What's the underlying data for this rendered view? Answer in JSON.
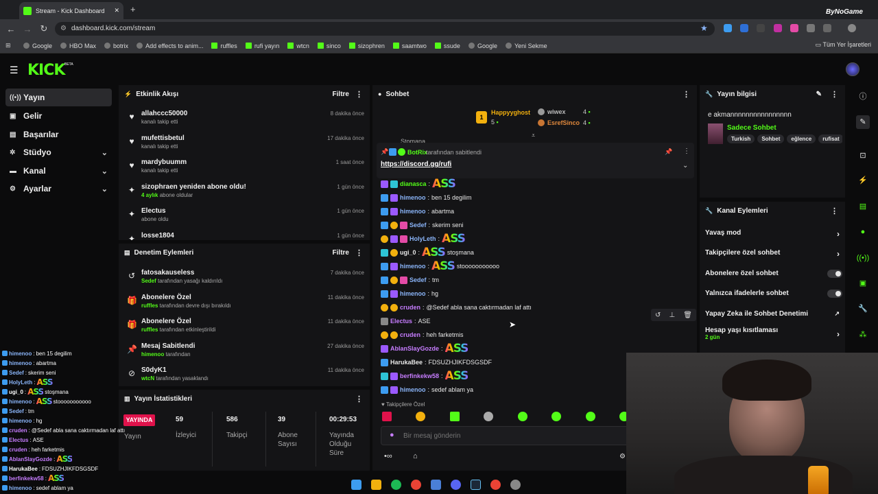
{
  "browser": {
    "tab_title": "Stream - Kick Dashboard",
    "url": "dashboard.kick.com/stream",
    "bookmarks": [
      "Google",
      "HBO Max",
      "botrix",
      "Add effects to anim...",
      "ruffles",
      "rufi yayın",
      "wtcn",
      "sinco",
      "sizophren",
      "saamtwo",
      "ssude",
      "Google",
      "Yeni Sekme"
    ],
    "all_bookmarks": "Tüm Yer İşaretleri",
    "overlay_brand": "ByNoGame"
  },
  "app": {
    "logo": "KICK",
    "beta": "BETA"
  },
  "nav": [
    {
      "label": "Yayın",
      "icon": "stream-icon",
      "active": true
    },
    {
      "label": "Gelir",
      "icon": "revenue-icon"
    },
    {
      "label": "Başarılar",
      "icon": "achievements-icon"
    },
    {
      "label": "Stüdyo",
      "icon": "studio-icon",
      "chevron": true
    },
    {
      "label": "Kanal",
      "icon": "channel-icon",
      "chevron": true
    },
    {
      "label": "Ayarlar",
      "icon": "settings-icon",
      "chevron": true
    }
  ],
  "activity": {
    "title": "Etkinlik Akışı",
    "filter": "Filtre",
    "events": [
      {
        "name": "allahccc50000",
        "sub": "kanalı takip etti",
        "time": "8 dakika önce",
        "icon": "heart-icon"
      },
      {
        "name": "mufettisbetul",
        "sub": "kanalı takip etti",
        "time": "17 dakika önce",
        "icon": "heart-icon"
      },
      {
        "name": "mardybuumm",
        "sub": "kanalı takip etti",
        "time": "1 saat önce",
        "icon": "heart-icon"
      },
      {
        "name": "sizophraen yeniden abone oldu!",
        "sub_hl": "4 aylık",
        "sub": " abone oldular",
        "time": "1 gün önce",
        "icon": "star-icon"
      },
      {
        "name": "Electus",
        "sub": "abone oldu",
        "time": "1 gün önce",
        "icon": "star-icon"
      },
      {
        "name": "losse1804",
        "sub": "",
        "time": "1 gün önce",
        "icon": "star-icon"
      }
    ]
  },
  "moderation": {
    "title": "Denetim Eylemleri",
    "filter": "Filtre",
    "events": [
      {
        "name": "fatosakauseless",
        "sub_hl": "Sedef",
        "sub": " tarafından yasağı kaldırıldı",
        "time": "7 dakika önce",
        "icon": "undo-icon"
      },
      {
        "name": "Abonelere Özel",
        "sub_hl": "ruffles",
        "sub": " tarafından devre dışı bırakıldı",
        "time": "11 dakika önce",
        "icon": "gift-icon"
      },
      {
        "name": "Abonelere Özel",
        "sub_hl": "ruffles",
        "sub": " tarafından etkinleştirildi",
        "time": "11 dakika önce",
        "icon": "gift-icon"
      },
      {
        "name": "Mesaj Sabitlendi",
        "sub_hl": "himenoo",
        "sub": " tarafından",
        "time": "27 dakika önce",
        "icon": "pin-icon"
      },
      {
        "name": "S0dyK1",
        "sub_hl": "wtcN",
        "sub": " tarafından yasaklandı",
        "time": "11 dakika önce",
        "icon": "ban-icon"
      }
    ]
  },
  "stats": {
    "title": "Yayın İstatistikleri",
    "live_badge": "YAYINDA",
    "live_label": "Yayın",
    "items": [
      {
        "value": "59",
        "label": "İzleyici"
      },
      {
        "value": "586",
        "label": "Takipçi"
      },
      {
        "value": "39",
        "label": "Abone Sayısı"
      },
      {
        "value": "00:29:53",
        "label": "Yayında Olduğu Süre"
      }
    ]
  },
  "chat": {
    "title": "Sohbet",
    "leaderboard": [
      {
        "name": "Happyyghost",
        "count": "5"
      },
      {
        "name": "wiwex",
        "count": "4"
      },
      {
        "name": "EsrefSinco",
        "count": "4"
      }
    ],
    "pinned_by": "BotRix",
    "pinned_suffix": "tarafından sabitlendi",
    "pinned_link": "https://discord.gg/rufi",
    "peek_name": "Stomana",
    "messages": [
      {
        "user": "dianasca",
        "color": "#53fc18",
        "text": "",
        "emote": "ASS",
        "badges": [
          "purple",
          "cyan"
        ]
      },
      {
        "user": "himenoo",
        "color": "#8ab4f8",
        "text": "ben 15 degilim",
        "badges": [
          "blue",
          "purple"
        ]
      },
      {
        "user": "himenoo",
        "color": "#8ab4f8",
        "text": "abartma",
        "badges": [
          "blue",
          "purple"
        ]
      },
      {
        "user": "Sedef",
        "color": "#8ab4f8",
        "text": "skerim seni",
        "badges": [
          "blue",
          "gold",
          "pink"
        ]
      },
      {
        "user": "HolyLeth",
        "color": "#8ab4f8",
        "text": "",
        "emote": "ASS",
        "badges": [
          "gold",
          "purple",
          "pink"
        ]
      },
      {
        "user": "ugi_0",
        "color": "#e8e8e8",
        "text": "stoşmana",
        "emote": "ASS",
        "badges": [
          "cyan",
          "gold"
        ]
      },
      {
        "user": "himenoo",
        "color": "#8ab4f8",
        "text": "stooooooooooo",
        "emote": "ASS",
        "badges": [
          "blue",
          "purple"
        ]
      },
      {
        "user": "Sedef",
        "color": "#8ab4f8",
        "text": "tm",
        "badges": [
          "blue",
          "gold",
          "pink"
        ]
      },
      {
        "user": "himenoo",
        "color": "#8ab4f8",
        "text": "hg",
        "badges": [
          "blue",
          "purple"
        ]
      },
      {
        "user": "cruden",
        "color": "#c77dff",
        "text": "@Sedef abla sana caktırmadan laf attı",
        "badges": [
          "gold",
          "gold"
        ]
      },
      {
        "user": "Electus",
        "color": "#c77dff",
        "text": "ASE",
        "badges": [
          "gray"
        ]
      },
      {
        "user": "cruden",
        "color": "#c77dff",
        "text": "heh farketmis",
        "badges": [
          "gold",
          "gold"
        ]
      },
      {
        "user": "AblanSlayGozde",
        "color": "#c77dff",
        "text": "",
        "emote": "ASS",
        "badges": [
          "purple"
        ]
      },
      {
        "user": "HarukaBee",
        "color": "#e8e8e8",
        "text": "FDSUZHJIKFDSGSDF",
        "badges": [
          "blue"
        ]
      },
      {
        "user": "berfinkekw58",
        "color": "#c77dff",
        "text": "",
        "emote": "ASS",
        "badges": [
          "cyan",
          "purple"
        ]
      },
      {
        "user": "himenoo",
        "color": "#8ab4f8",
        "text": "sedef ablam ya",
        "badges": [
          "blue",
          "purple"
        ]
      }
    ],
    "followers_only": "Takipçilere Özel",
    "placeholder": "Bir mesaj gönderin"
  },
  "stream_info": {
    "title": "Yayın bilgisi",
    "stream_title": "e akmannnnnnnnnnnnnnnn",
    "category": "Sadece Sohbet",
    "tags": [
      "Turkish",
      "Sohbet",
      "eğlence",
      "rufisat"
    ]
  },
  "channel_actions": {
    "title": "Kanal Eylemleri",
    "items": [
      {
        "label": "Yavaş mod",
        "type": "arrow"
      },
      {
        "label": "Takipçilere özel sohbet",
        "type": "arrow"
      },
      {
        "label": "Abonelere özel sohbet",
        "type": "toggle"
      },
      {
        "label": "Yalnızca ifadelerle sohbet",
        "type": "toggle"
      },
      {
        "label": "Yapay Zeka ile Sohbet Denetimi",
        "type": "external"
      },
      {
        "label": "Hesap yaşı kısıtlaması",
        "sub": "2 gün",
        "type": "arrow"
      }
    ]
  },
  "overlay": [
    {
      "user": "himenoo",
      "text": "ben 15 degilim",
      "color": "#8ab4f8"
    },
    {
      "user": "himenoo",
      "text": "abartma",
      "color": "#8ab4f8"
    },
    {
      "user": "Sedef",
      "text": "skerim seni",
      "color": "#8ab4f8"
    },
    {
      "user": "HolyLeth",
      "text": "",
      "emote": "ASS",
      "color": "#8ab4f8"
    },
    {
      "user": "ugi_0",
      "text": "stoşmana",
      "emote": "ASS",
      "color": "#fff"
    },
    {
      "user": "himenoo",
      "text": "stooooooooooo",
      "emote": "ASS",
      "color": "#8ab4f8"
    },
    {
      "user": "Sedef",
      "text": "tm",
      "color": "#8ab4f8"
    },
    {
      "user": "himenoo",
      "text": "hg",
      "color": "#8ab4f8"
    },
    {
      "user": "cruden",
      "text": "@Sedef abla sana caktırmadan laf attı",
      "color": "#c77dff"
    },
    {
      "user": "Electus",
      "text": "ASE",
      "color": "#c77dff"
    },
    {
      "user": "cruden",
      "text": "heh farketmis",
      "color": "#c77dff"
    },
    {
      "user": "AblanSlayGozde",
      "text": "",
      "emote": "ASS",
      "color": "#c77dff"
    },
    {
      "user": "HarukaBee",
      "text": "FDSUZHJIKFDSGSDF",
      "color": "#fff"
    },
    {
      "user": "berfinkekw58",
      "text": "",
      "emote": "ASS",
      "color": "#c77dff"
    },
    {
      "user": "himenoo",
      "text": "sedef ablam ya",
      "color": "#8ab4f8"
    }
  ],
  "colors": {
    "accent": "#53fc18",
    "panel": "#141416",
    "bg": "#0b0b0c",
    "live": "#e0124b"
  }
}
